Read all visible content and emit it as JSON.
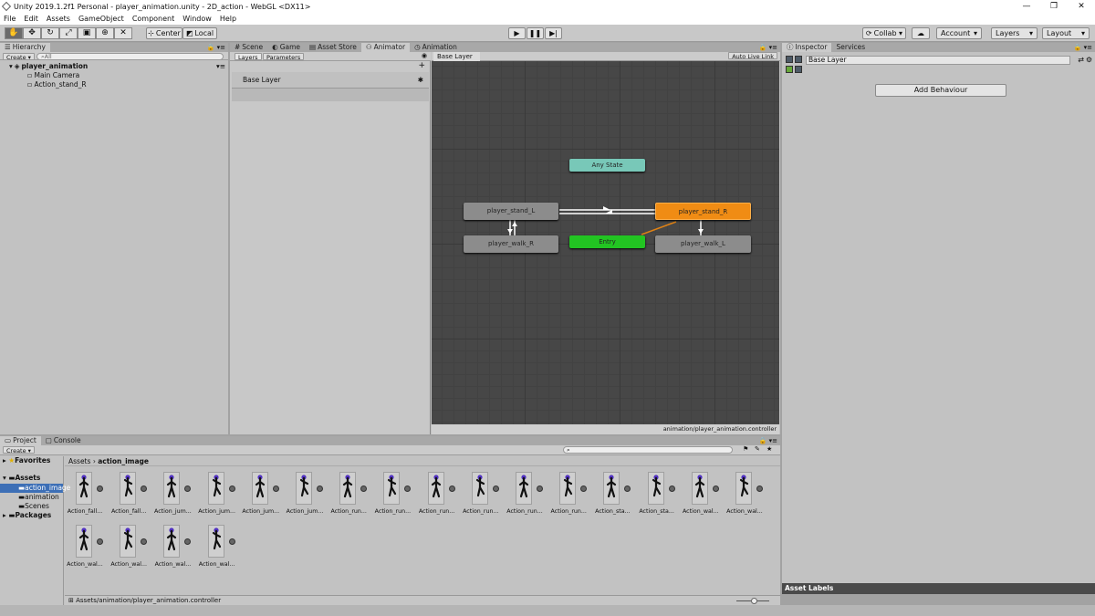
{
  "window": {
    "title": "Unity 2019.1.2f1 Personal - player_animation.unity - 2D_action - WebGL <DX11>",
    "minimize": "—",
    "maximize": "❐",
    "close": "✕"
  },
  "menu": [
    "File",
    "Edit",
    "Assets",
    "GameObject",
    "Component",
    "Window",
    "Help"
  ],
  "toolbar": {
    "pivot_label": "Center",
    "space_label": "Local",
    "collab_label": "Collab ▾",
    "account_label": "Account",
    "layers_label": "Layers",
    "layout_label": "Layout"
  },
  "hierarchy": {
    "tab": "Hierarchy",
    "create": "Create",
    "search_placeholder": "All",
    "scene": "player_animation",
    "items": [
      "Main Camera",
      "Action_stand_R"
    ]
  },
  "center_tabs": [
    "Scene",
    "Game",
    "Asset Store",
    "Animator",
    "Animation"
  ],
  "animator": {
    "left_tabs": [
      "Layers",
      "Parameters"
    ],
    "layer_name": "Base Layer",
    "breadcrumb": "Base Layer",
    "auto_live_link": "Auto Live Link",
    "controller_path": "animation/player_animation.controller",
    "states": {
      "any": "Any State",
      "stand_L": "player_stand_L",
      "stand_R": "player_stand_R",
      "walk_R": "player_walk_R",
      "entry": "Entry",
      "walk_L": "player_walk_L"
    }
  },
  "inspector": {
    "tabs": [
      "Inspector",
      "Services"
    ],
    "name": "Base Layer",
    "add_behaviour": "Add Behaviour",
    "asset_labels": "Asset Labels"
  },
  "project": {
    "tabs": [
      "Project",
      "Console"
    ],
    "create": "Create",
    "favorites": "Favorites",
    "assets_root": "Assets",
    "folders": [
      "action_image",
      "animation",
      "Scenes"
    ],
    "packages": "Packages",
    "breadcrumb_root": "Assets",
    "breadcrumb_current": "action_image",
    "status_path": "Assets/animation/player_animation.controller",
    "assets_row1": [
      "Action_fall...",
      "Action_fall...",
      "Action_jum...",
      "Action_jum...",
      "Action_jum...",
      "Action_jum...",
      "Action_run...",
      "Action_run...",
      "Action_run...",
      "Action_run...",
      "Action_run...",
      "Action_run...",
      "Action_sta...",
      "Action_sta...",
      "Action_wal...",
      "Action_wal..."
    ],
    "assets_row2": [
      "Action_wal...",
      "Action_wal...",
      "Action_wal...",
      "Action_wal..."
    ]
  },
  "colors": {
    "orange_state": "#f08c14",
    "entry_state": "#22c422",
    "any_state": "#78c8b8",
    "gray_state": "#8c8c8c"
  }
}
